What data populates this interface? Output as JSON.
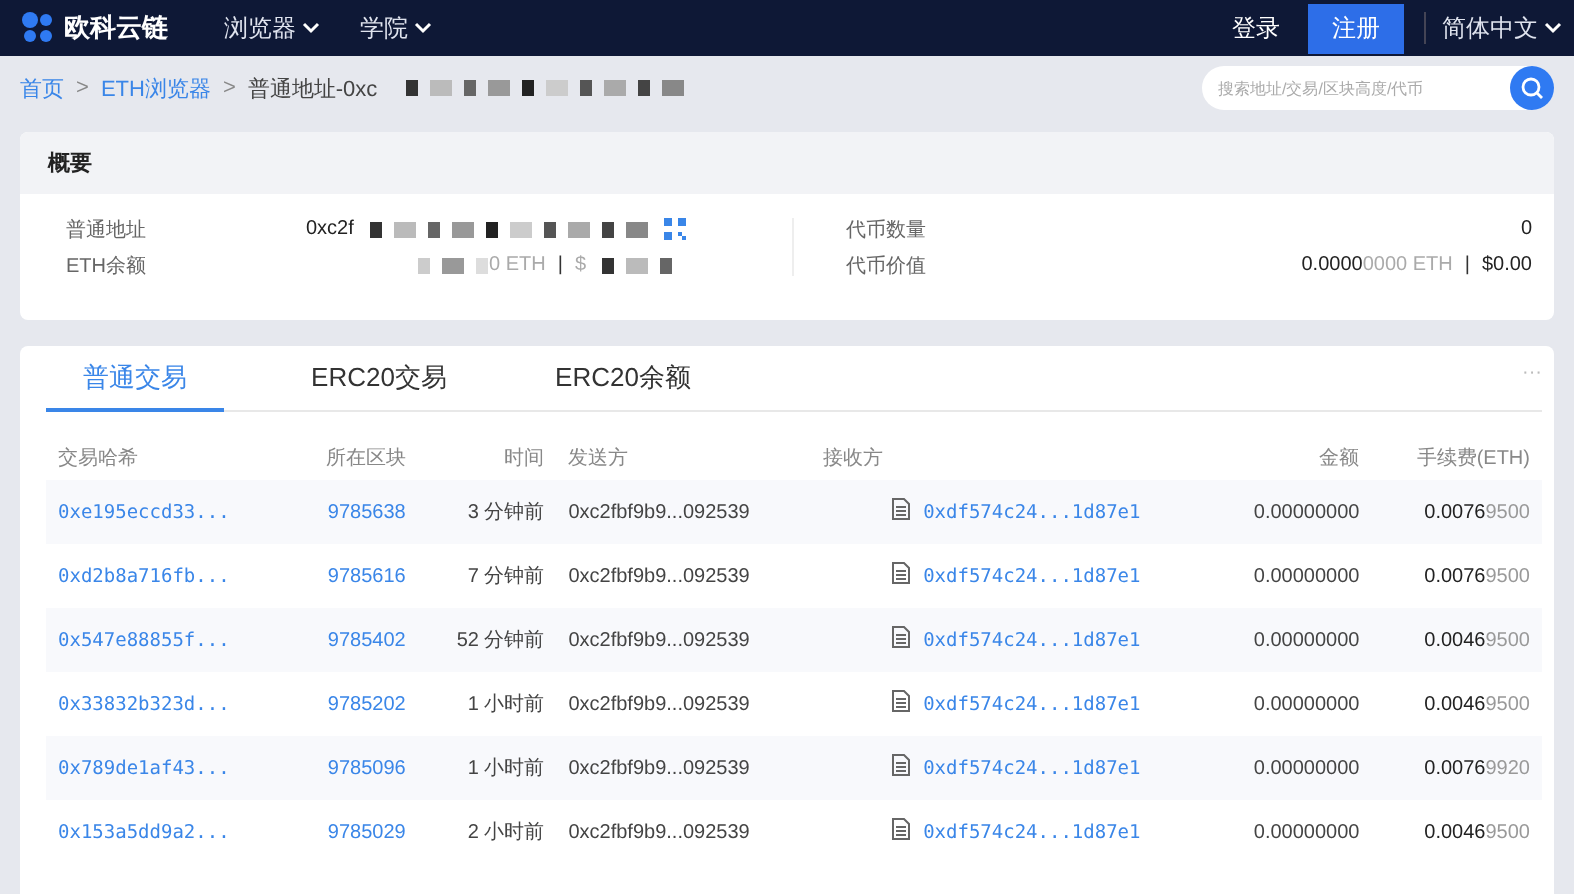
{
  "header": {
    "logo": "欧科云链",
    "nav": [
      {
        "label": "浏览器"
      },
      {
        "label": "学院"
      }
    ],
    "login": "登录",
    "register": "注册",
    "language": "简体中文"
  },
  "breadcrumb": {
    "items": [
      {
        "label": "首页",
        "link": true
      },
      {
        "label": "ETH浏览器",
        "link": true
      },
      {
        "label": "普通地址-0xc",
        "link": false
      }
    ],
    "separator": ">"
  },
  "search": {
    "placeholder": "搜索地址/交易/区块高度/代币"
  },
  "overview": {
    "title": "概要",
    "left": [
      {
        "label": "普通地址",
        "value": "0xc2f",
        "redacted": true,
        "qr": true
      },
      {
        "label": "ETH余额",
        "value": "0 ETH",
        "separator": "|",
        "value2": "$",
        "redacted": true,
        "qr": false
      }
    ],
    "right": [
      {
        "label": "代币数量",
        "value_main": "0"
      },
      {
        "label": "代币价值",
        "value_main": "0.0000",
        "value_tail": "0000 ETH",
        "separator": "|",
        "value2": "$0.00"
      }
    ]
  },
  "tabs": [
    {
      "label": "普通交易",
      "selected": true
    },
    {
      "label": "ERC20交易",
      "selected": false
    },
    {
      "label": "ERC20余额",
      "selected": false
    }
  ],
  "more": "···",
  "table": {
    "columns": [
      "交易哈希",
      "所在区块",
      "时间",
      "发送方",
      "接收方",
      "金额",
      "手续费(ETH)"
    ],
    "rows": [
      {
        "hash": "0xe195eccd33...",
        "block": "9785638",
        "time": "3 分钟前",
        "from": "0xc2fbf9b9...092539",
        "to": "0xdf574c24...1d87e1",
        "amount": "0.00000000",
        "fee_main": "0.0076",
        "fee_tail": "9500"
      },
      {
        "hash": "0xd2b8a716fb...",
        "block": "9785616",
        "time": "7 分钟前",
        "from": "0xc2fbf9b9...092539",
        "to": "0xdf574c24...1d87e1",
        "amount": "0.00000000",
        "fee_main": "0.0076",
        "fee_tail": "9500"
      },
      {
        "hash": "0x547e88855f...",
        "block": "9785402",
        "time": "52 分钟前",
        "from": "0xc2fbf9b9...092539",
        "to": "0xdf574c24...1d87e1",
        "amount": "0.00000000",
        "fee_main": "0.0046",
        "fee_tail": "9500"
      },
      {
        "hash": "0x33832b323d...",
        "block": "9785202",
        "time": "1 小时前",
        "from": "0xc2fbf9b9...092539",
        "to": "0xdf574c24...1d87e1",
        "amount": "0.00000000",
        "fee_main": "0.0046",
        "fee_tail": "9500"
      },
      {
        "hash": "0x789de1af43...",
        "block": "9785096",
        "time": "1 小时前",
        "from": "0xc2fbf9b9...092539",
        "to": "0xdf574c24...1d87e1",
        "amount": "0.00000000",
        "fee_main": "0.0076",
        "fee_tail": "9920"
      },
      {
        "hash": "0x153a5dd9a2...",
        "block": "9785029",
        "time": "2 小时前",
        "from": "0xc2fbf9b9...092539",
        "to": "0xdf574c24...1d87e1",
        "amount": "0.00000000",
        "fee_main": "0.0046",
        "fee_tail": "9500"
      }
    ]
  }
}
